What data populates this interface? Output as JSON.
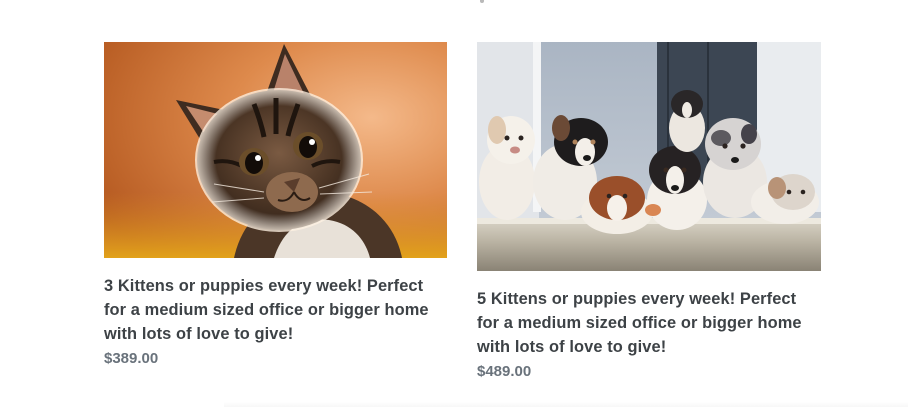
{
  "products": [
    {
      "title": "3 Kittens or puppies every week! Perfect for a medium sized office or bigger home with lots of love to give!",
      "price": "$389.00",
      "image": "kitten-photo"
    },
    {
      "title": "5 Kittens or puppies every week! Perfect for a medium sized office or bigger home with lots of love to give!",
      "price": "$489.00",
      "image": "puppies-photo"
    }
  ]
}
